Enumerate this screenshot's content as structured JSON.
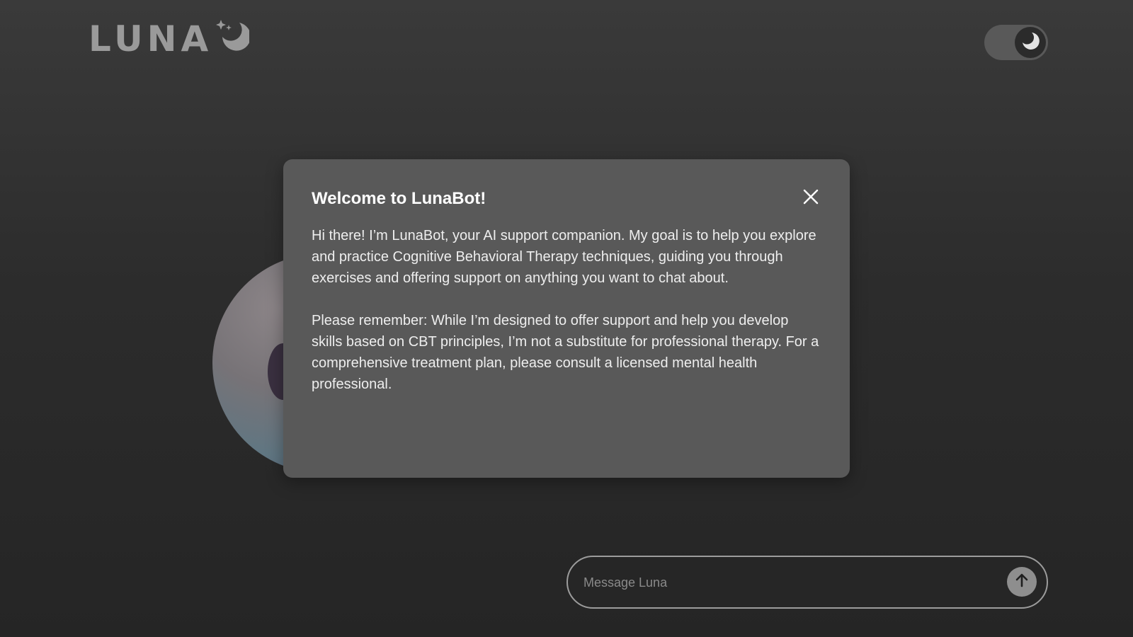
{
  "header": {
    "logo_text": "LUNA",
    "logo_icon": "crescent-moon-stars-icon",
    "theme_toggle": {
      "state": "dark",
      "icon": "moon-icon"
    }
  },
  "modal": {
    "title": "Welcome to LunaBot!",
    "close_icon": "close-icon",
    "paragraphs": [
      "Hi there! I’m LunaBot, your AI support companion. My goal is to help you explore and practice Cognitive Behavioral Therapy techniques, guiding you through exercises and offering support on anything you want to chat about.",
      "Please remember: While I’m designed to offer support and help you develop skills based on CBT principles, I’m not a substitute for professional therapy. For a comprehensive treatment plan, please consult a licensed mental health professional."
    ]
  },
  "chat": {
    "placeholder": "Message Luna",
    "value": "",
    "send_icon": "arrow-up-icon"
  },
  "colors": {
    "background_top": "#3a3a3a",
    "background_bottom": "#252525",
    "modal_background": "#595959",
    "logo": "#9a9a9a",
    "send_button": "#8e8e8e"
  }
}
